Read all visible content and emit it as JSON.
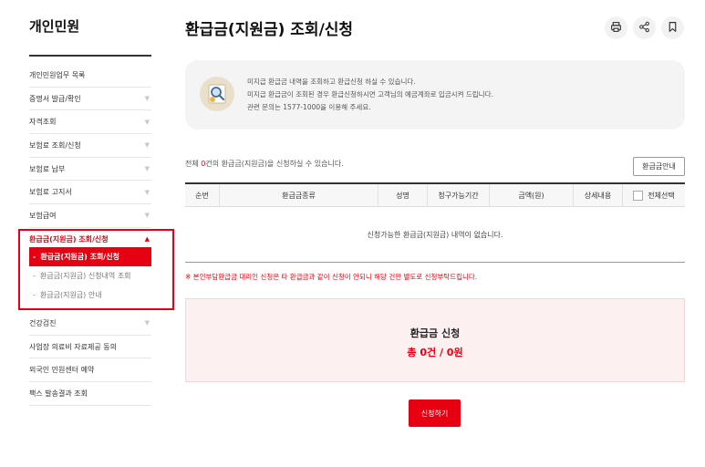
{
  "sidebar": {
    "title": "개인민원",
    "items_top": [
      {
        "label": "개인민원업무 목록",
        "arrow": false
      },
      {
        "label": "증명서 발급/확인",
        "arrow": true
      },
      {
        "label": "자격조회",
        "arrow": true
      },
      {
        "label": "보험료 조회/신청",
        "arrow": true
      },
      {
        "label": "보험료 납부",
        "arrow": true
      },
      {
        "label": "보험료 고지서",
        "arrow": true
      },
      {
        "label": "보험급여",
        "arrow": true
      }
    ],
    "active": {
      "label": "환급금(지원금) 조회/신청",
      "subs": [
        {
          "label": "환급금(지원금) 조회/신청",
          "active": true
        },
        {
          "label": "환급금(지원금) 신청내역 조회",
          "active": false
        },
        {
          "label": "환급금(지원금) 안내",
          "active": false
        }
      ]
    },
    "items_bottom": [
      {
        "label": "건강검진",
        "arrow": true
      },
      {
        "label": "사업장 의료비 자료제공 동의",
        "arrow": false
      },
      {
        "label": "외국인 민원센터 예약",
        "arrow": false
      },
      {
        "label": "팩스 발송결과 조회",
        "arrow": false
      }
    ]
  },
  "page": {
    "title": "환급금(지원금) 조회/신청",
    "tools": [
      "print-icon",
      "share-icon",
      "bookmark-icon"
    ]
  },
  "notice": {
    "icon": "search-money-icon",
    "lines": [
      "미지급 환급금 내역을 조회하고 환급신청 하실 수 있습니다.",
      "미지급 환급금이 조회된 경우 환급신청하시면 고객님의 예금계좌로 입금시켜 드립니다.",
      "관련 문의는 1577-1000을 이용해 주세요."
    ]
  },
  "list": {
    "count_prefix": "전체 ",
    "count": "0",
    "count_suffix": "건의 환급금(지원금)을 신청하실 수 있습니다.",
    "guide_button": "환급금안내",
    "columns": [
      "순번",
      "환급금종류",
      "성명",
      "청구가능기간",
      "금액(원)",
      "상세내용",
      "전체선택"
    ],
    "empty_message": "신청가능한 환급금(지원금) 내역이 없습니다."
  },
  "warning": "※ 본인부담환급금 대리인 신청은 타 환급금과 같이 신청이 안되니 해당 건만 별도로 신청부탁드립니다.",
  "summary": {
    "title": "환급금 신청",
    "total": "총 0건 / 0원"
  },
  "apply_button": "신청하기",
  "colors": {
    "accent": "#e60012",
    "summary_bg": "#fdf0f0",
    "notice_bg": "#f4f4f4"
  }
}
